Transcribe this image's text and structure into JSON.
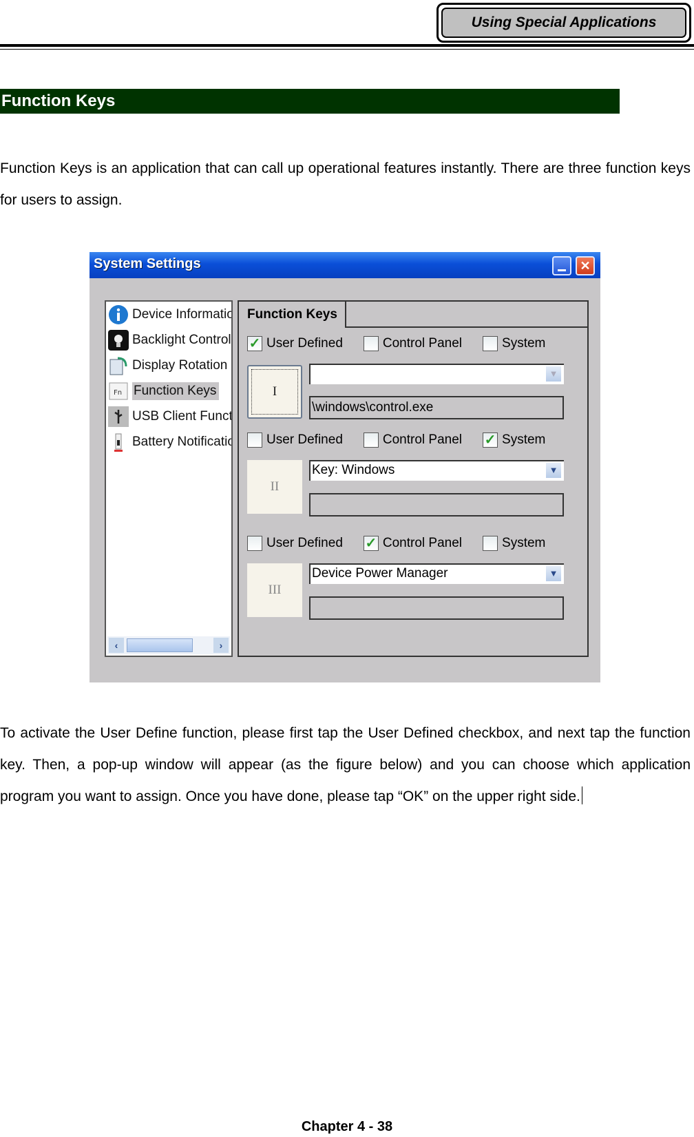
{
  "header": {
    "chapter_tab": "Using Special Applications"
  },
  "section": {
    "title": "Function Keys"
  },
  "intro": "Function Keys is an application that can call up operational features instantly. There are three function keys for users to assign.",
  "window": {
    "title": "System Settings",
    "minimize_icon": "minimize-icon",
    "close_icon": "close-icon",
    "sidebar": [
      {
        "label": "Device Information",
        "icon": "info-icon",
        "selected": false
      },
      {
        "label": "Backlight Control",
        "icon": "lightbulb-icon",
        "selected": false
      },
      {
        "label": "Display Rotation",
        "icon": "rotation-icon",
        "selected": false
      },
      {
        "label": "Function Keys",
        "icon": "fn-key-icon",
        "selected": true
      },
      {
        "label": "USB Client Function",
        "icon": "usb-icon",
        "selected": false
      },
      {
        "label": "Battery Notification",
        "icon": "battery-icon",
        "selected": false
      }
    ],
    "tab": "Function Keys",
    "checkbox_labels": {
      "user": "User Defined",
      "control": "Control Panel",
      "system": "System"
    },
    "keys": [
      {
        "key_label": "I",
        "user_defined": true,
        "control_panel": false,
        "system": false,
        "combo_value": "",
        "path": "\\windows\\control.exe"
      },
      {
        "key_label": "II",
        "user_defined": false,
        "control_panel": false,
        "system": true,
        "combo_value": "Key: Windows",
        "path": ""
      },
      {
        "key_label": "III",
        "user_defined": false,
        "control_panel": true,
        "system": false,
        "combo_value": "Device Power Manager",
        "path": ""
      }
    ]
  },
  "body_text": "To activate the User Define function, please first tap the User Defined checkbox, and next tap the function key. Then, a pop-up window will appear (as the figure below) and you can choose which application program you want to assign. Once you have done, please tap “OK” on the upper right side.",
  "footer": {
    "page": "Chapter 4 - 38"
  }
}
